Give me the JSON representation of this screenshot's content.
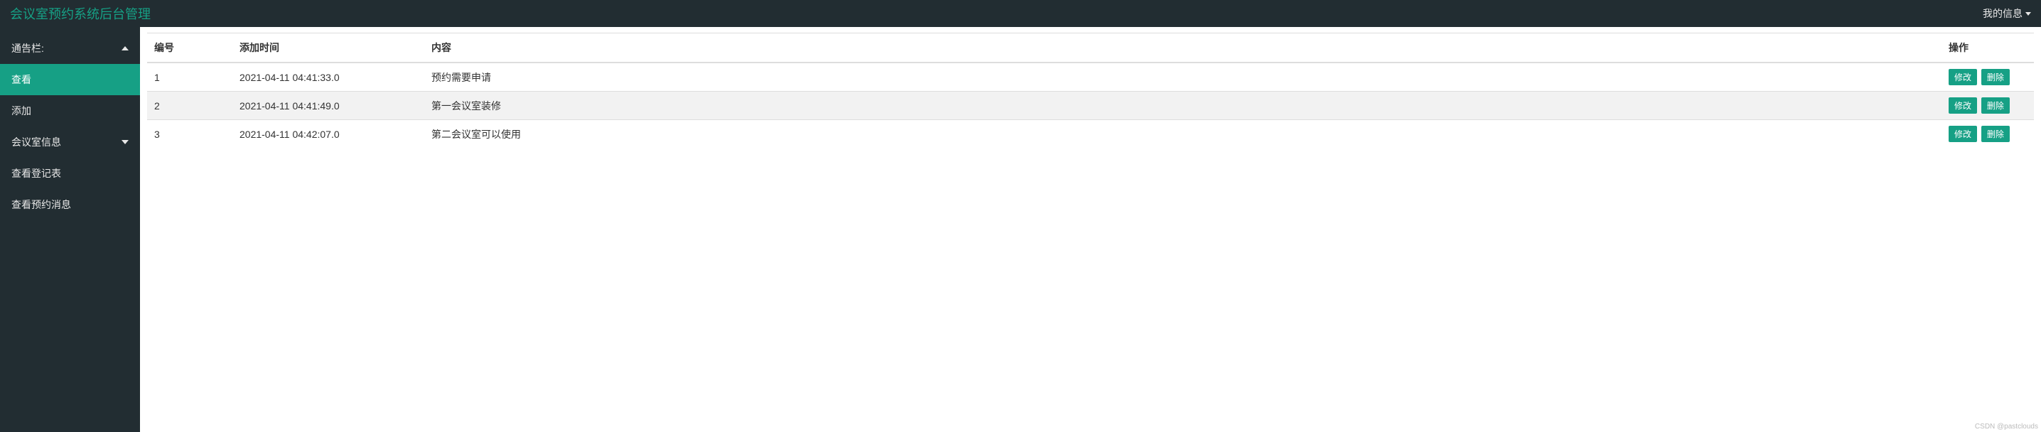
{
  "header": {
    "title": "会议室预约系统后台管理",
    "myinfo": "我的信息"
  },
  "sidebar": {
    "items": [
      {
        "label": "通告栏:",
        "type": "header",
        "expanded": true
      },
      {
        "label": "查看",
        "type": "item",
        "active": true
      },
      {
        "label": "添加",
        "type": "item"
      },
      {
        "label": "会议室信息",
        "type": "header",
        "expanded": false
      },
      {
        "label": "查看登记表",
        "type": "item"
      },
      {
        "label": "查看预约消息",
        "type": "item"
      }
    ]
  },
  "table": {
    "columns": [
      "编号",
      "添加时间",
      "内容",
      "操作"
    ],
    "rows": [
      {
        "id": "1",
        "time": "2021-04-11 04:41:33.0",
        "content": "预约需要申请"
      },
      {
        "id": "2",
        "time": "2021-04-11 04:41:49.0",
        "content": "第一会议室装修"
      },
      {
        "id": "3",
        "time": "2021-04-11 04:42:07.0",
        "content": "第二会议室可以使用"
      }
    ],
    "actions": {
      "edit": "修改",
      "delete": "删除"
    }
  },
  "watermark": "CSDN @pastclouds"
}
